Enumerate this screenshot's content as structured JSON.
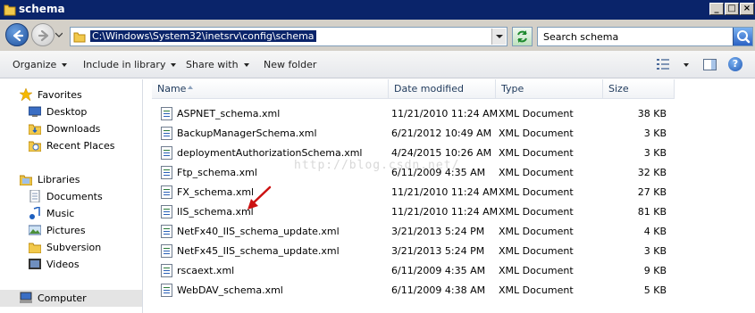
{
  "window": {
    "title": "schema"
  },
  "address": {
    "path": "C:\\Windows\\System32\\inetsrv\\config\\schema"
  },
  "search": {
    "placeholder": "Search schema"
  },
  "toolbar": {
    "organize": "Organize",
    "include_in_library": "Include in library",
    "share_with": "Share with",
    "new_folder": "New folder"
  },
  "nav": {
    "favorites": "Favorites",
    "desktop": "Desktop",
    "downloads": "Downloads",
    "recent_places": "Recent Places",
    "libraries": "Libraries",
    "documents": "Documents",
    "music": "Music",
    "pictures": "Pictures",
    "subversion": "Subversion",
    "videos": "Videos",
    "computer": "Computer"
  },
  "columns": {
    "name": "Name",
    "date_modified": "Date modified",
    "type": "Type",
    "size": "Size"
  },
  "files": [
    {
      "name": "ASPNET_schema.xml",
      "date": "11/21/2010 11:24 AM",
      "type": "XML Document",
      "size": "38 KB"
    },
    {
      "name": "BackupManagerSchema.xml",
      "date": "6/21/2012 10:49 AM",
      "type": "XML Document",
      "size": "3 KB"
    },
    {
      "name": "deploymentAuthorizationSchema.xml",
      "date": "4/24/2015 10:26 AM",
      "type": "XML Document",
      "size": "3 KB"
    },
    {
      "name": "Ftp_schema.xml",
      "date": "6/11/2009 4:35 AM",
      "type": "XML Document",
      "size": "32 KB"
    },
    {
      "name": "FX_schema.xml",
      "date": "11/21/2010 11:24 AM",
      "type": "XML Document",
      "size": "27 KB"
    },
    {
      "name": "IIS_schema.xml",
      "date": "11/21/2010 11:24 AM",
      "type": "XML Document",
      "size": "81 KB"
    },
    {
      "name": "NetFx40_IIS_schema_update.xml",
      "date": "3/21/2013 5:24 PM",
      "type": "XML Document",
      "size": "4 KB"
    },
    {
      "name": "NetFx45_IIS_schema_update.xml",
      "date": "3/21/2013 5:24 PM",
      "type": "XML Document",
      "size": "3 KB"
    },
    {
      "name": "rscaext.xml",
      "date": "6/11/2009 4:35 AM",
      "type": "XML Document",
      "size": "9 KB"
    },
    {
      "name": "WebDAV_schema.xml",
      "date": "6/11/2009 4:38 AM",
      "type": "XML Document",
      "size": "5 KB"
    }
  ],
  "watermark": "http://blog.csdn.net/",
  "colors": {
    "titlebar": "#0a246a",
    "selection": "#0a246a",
    "arrow": "#cc1111"
  }
}
